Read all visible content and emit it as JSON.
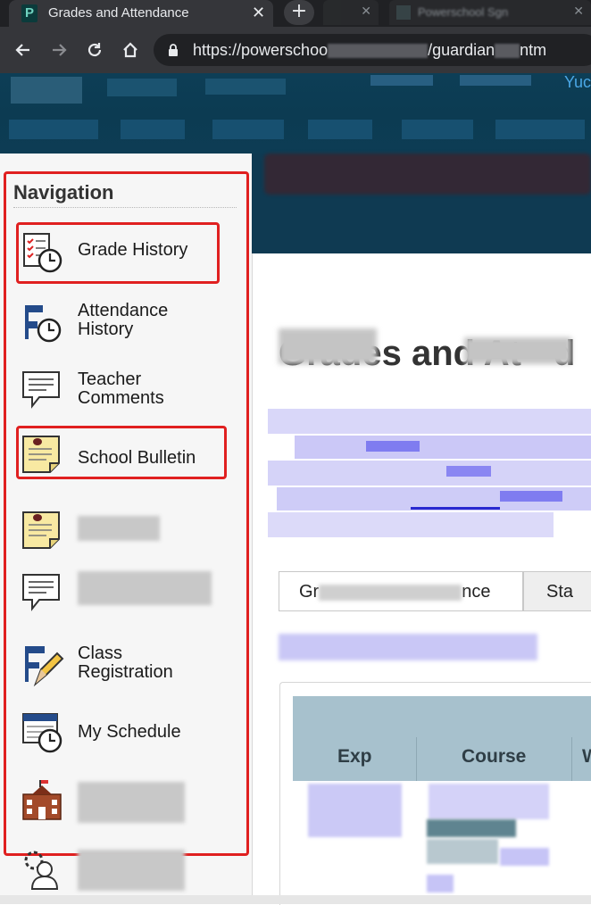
{
  "browser": {
    "active_tab": {
      "title": "Grades and Attendance",
      "favicon": "P",
      "close_glyph": "✕"
    },
    "new_tab_glyph": "+",
    "other_tabs": [
      {
        "title": "",
        "close_glyph": "✕"
      },
      {
        "title": "Powerschool Sgn",
        "close_glyph": "✕"
      }
    ],
    "nav_icons": [
      "back-arrow-icon",
      "forward-arrow-icon",
      "reload-icon",
      "home-icon",
      "lock-icon"
    ],
    "url_prefix": "https://powerschoo",
    "url_middle": "/guardian",
    "url_suffix": "ntm"
  },
  "header": {
    "links": [
      "Yuc"
    ]
  },
  "navigation": {
    "heading": "Navigation",
    "items": [
      {
        "icon": "grade-history-icon",
        "label": "Grade History",
        "highlighted": true
      },
      {
        "icon": "attendance-history-icon",
        "label": "Attendance History",
        "highlighted": false
      },
      {
        "icon": "teacher-comments-icon",
        "label": "Teacher Comments",
        "highlighted": false
      },
      {
        "icon": "school-bulletin-icon",
        "label": "School Bulletin",
        "highlighted": true
      },
      {
        "icon": "bulletin-icon",
        "label": "",
        "highlighted": false
      },
      {
        "icon": "comments-icon",
        "label": "",
        "highlighted": false
      },
      {
        "icon": "class-registration-icon",
        "label": "Class Registration",
        "highlighted": false
      },
      {
        "icon": "my-schedule-icon",
        "label": "My Schedule",
        "highlighted": false
      },
      {
        "icon": "school-building-icon",
        "label": "",
        "highlighted": false
      },
      {
        "icon": "account-settings-icon",
        "label": "",
        "highlighted": false
      }
    ]
  },
  "main": {
    "title": "Grades and At",
    "title_tail": "d",
    "tabs": [
      {
        "label_start": "Gr",
        "label_end": "nce",
        "active": true
      },
      {
        "label_start": "Sta",
        "label_end": "",
        "active": false
      }
    ],
    "table": {
      "headers": [
        "Exp",
        "Course",
        "W"
      ]
    }
  },
  "colors": {
    "header_bg": "#0d3e56",
    "highlight_red": "#e02020",
    "table_header_bg": "#a7c1cd",
    "link_blur": "#b9b6f4"
  }
}
